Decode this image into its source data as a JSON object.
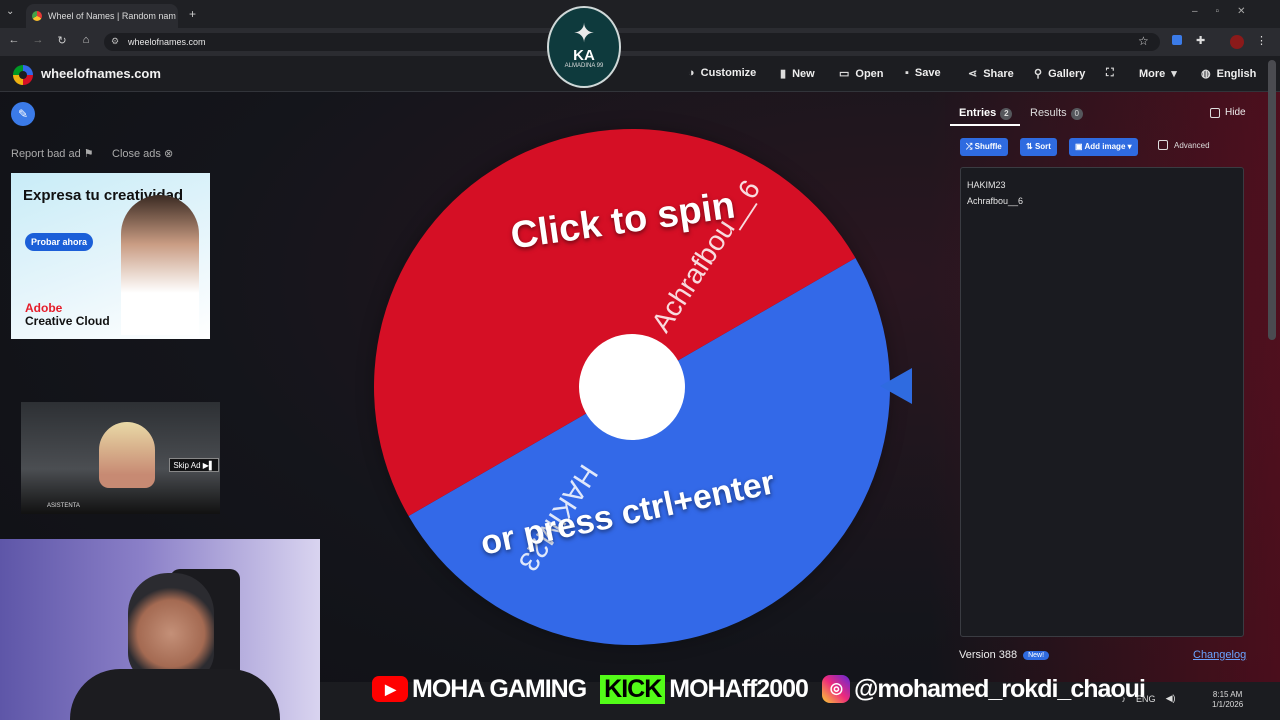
{
  "browser": {
    "tab_title": "Wheel of Names | Random nam",
    "tab_close": "✕",
    "new_tab": "+",
    "url": "wheelofnames.com"
  },
  "emblem": {
    "monogram": "KA",
    "sub": "ALMADINA 99"
  },
  "header": {
    "site_name": "wheelofnames.com",
    "menu": [
      {
        "label": "Customize",
        "icon": "palette-icon",
        "glyph": "◑"
      },
      {
        "label": "New",
        "icon": "new-file-icon",
        "glyph": "▮"
      },
      {
        "label": "Open",
        "icon": "folder-icon",
        "glyph": "▭"
      },
      {
        "label": "Save",
        "icon": "save-icon",
        "glyph": "▪"
      },
      {
        "label": "Share",
        "icon": "share-icon",
        "glyph": "⋖"
      },
      {
        "label": "Gallery",
        "icon": "search-icon",
        "glyph": "⚲"
      },
      {
        "label": "",
        "icon": "fullscreen-icon",
        "glyph": "⛶"
      },
      {
        "label": "More",
        "icon": "chevron-down-icon",
        "glyph": "▾"
      },
      {
        "label": "English",
        "icon": "globe-icon",
        "glyph": "◍"
      }
    ]
  },
  "left": {
    "report_ad": "Report bad ad",
    "close_ads": "Close ads",
    "ad1": {
      "headline": "Expresa tu creatividad",
      "cta": "Probar ahora",
      "brand_line1": "Adobe",
      "brand_line2": "Creative Cloud"
    },
    "ad2": {
      "skip": "Skip Ad ▶▌",
      "caption": "ASISTENTA"
    }
  },
  "wheel": {
    "entries": [
      "HAKIM23",
      "Achrafbou__6"
    ],
    "colors": [
      "#3369e8",
      "#d50f25"
    ],
    "hint_top": "Click to spin",
    "hint_bottom": "or press ctrl+enter"
  },
  "panel": {
    "tab_entries": "Entries",
    "entries_count": "2",
    "tab_results": "Results",
    "results_count": "0",
    "hide_label": "Hide",
    "shuffle": "Shuffle",
    "sort": "Sort",
    "add_image": "Add image",
    "advanced": "Advanced",
    "entries": [
      "HAKIM23",
      "Achrafbou__6"
    ],
    "version": "Version 388",
    "new_badge": "New!",
    "changelog": "Changelog"
  },
  "banner": {
    "youtube_name": "MOHA GAMING",
    "kick_label": "KICK",
    "kick_name": "MOHAff2000",
    "instagram_name": "@mohamed_rokdi_chaoui"
  },
  "taskbar": {
    "lang": "ENG",
    "time": "8:15 AM",
    "date": "1/1/2026"
  }
}
